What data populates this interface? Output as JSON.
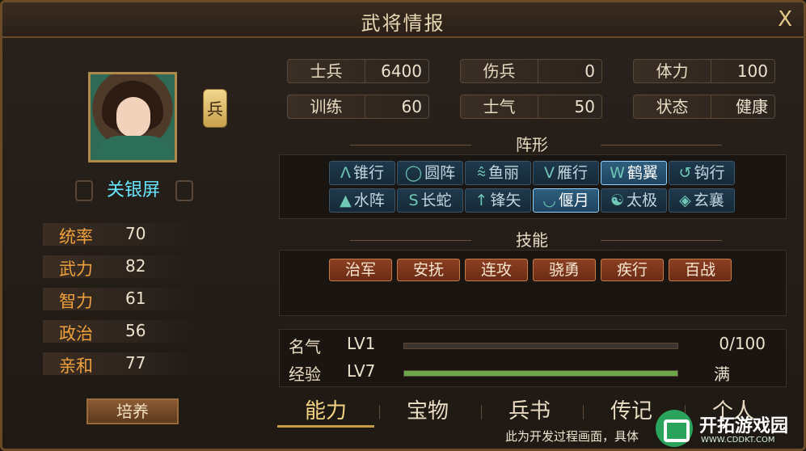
{
  "window": {
    "title": "武将情报",
    "close_label": "X"
  },
  "general": {
    "name": "关银屏",
    "type_badge": "兵",
    "stats": [
      {
        "label": "统率",
        "value": "70"
      },
      {
        "label": "武力",
        "value": "82"
      },
      {
        "label": "智力",
        "value": "61"
      },
      {
        "label": "政治",
        "value": "56"
      },
      {
        "label": "亲和",
        "value": "77"
      }
    ],
    "train_label": "培养"
  },
  "troops": [
    {
      "label": "士兵",
      "value": "6400"
    },
    {
      "label": "伤兵",
      "value": "0"
    },
    {
      "label": "体力",
      "value": "100"
    },
    {
      "label": "训练",
      "value": "60"
    },
    {
      "label": "士气",
      "value": "50"
    },
    {
      "label": "状态",
      "value": "健康"
    }
  ],
  "formation": {
    "title": "阵形",
    "items": [
      {
        "icon": "Ʌ",
        "label": "锥行",
        "active": false
      },
      {
        "icon": "◯",
        "label": "圆阵",
        "active": false
      },
      {
        "icon": "⩯",
        "label": "鱼丽",
        "active": false
      },
      {
        "icon": "V",
        "label": "雁行",
        "active": false
      },
      {
        "icon": "W",
        "label": "鹤翼",
        "active": true
      },
      {
        "icon": "↺",
        "label": "钩行",
        "active": false
      },
      {
        "icon": "▲",
        "label": "水阵",
        "active": false
      },
      {
        "icon": "S",
        "label": "长蛇",
        "active": false
      },
      {
        "icon": "↑",
        "label": "锋矢",
        "active": false
      },
      {
        "icon": "◡",
        "label": "偃月",
        "active": true
      },
      {
        "icon": "☯",
        "label": "太极",
        "active": false
      },
      {
        "icon": "◈",
        "label": "玄襄",
        "active": false
      }
    ]
  },
  "skills": {
    "title": "技能",
    "items": [
      "治军",
      "安抚",
      "连攻",
      "骁勇",
      "疾行",
      "百战"
    ]
  },
  "progress": {
    "fame": {
      "label": "名气",
      "level": "LV1",
      "value_text": "0/100",
      "fraction": 0.0
    },
    "exp": {
      "label": "经验",
      "level": "LV7",
      "value_text": "满",
      "fraction": 1.0
    }
  },
  "tabs": [
    "能力",
    "宝物",
    "兵书",
    "传记",
    "个人"
  ],
  "footer": {
    "notice": "此为开发过程画面，具体"
  },
  "logo": {
    "name": "开拓游戏园",
    "url": "WWW.CDDKT.COM"
  },
  "colors": {
    "stat_label": "#f0a13b",
    "name": "#67e7ff",
    "exp_fill": "#6aa84a",
    "skill_bg": "#8c3f22"
  }
}
